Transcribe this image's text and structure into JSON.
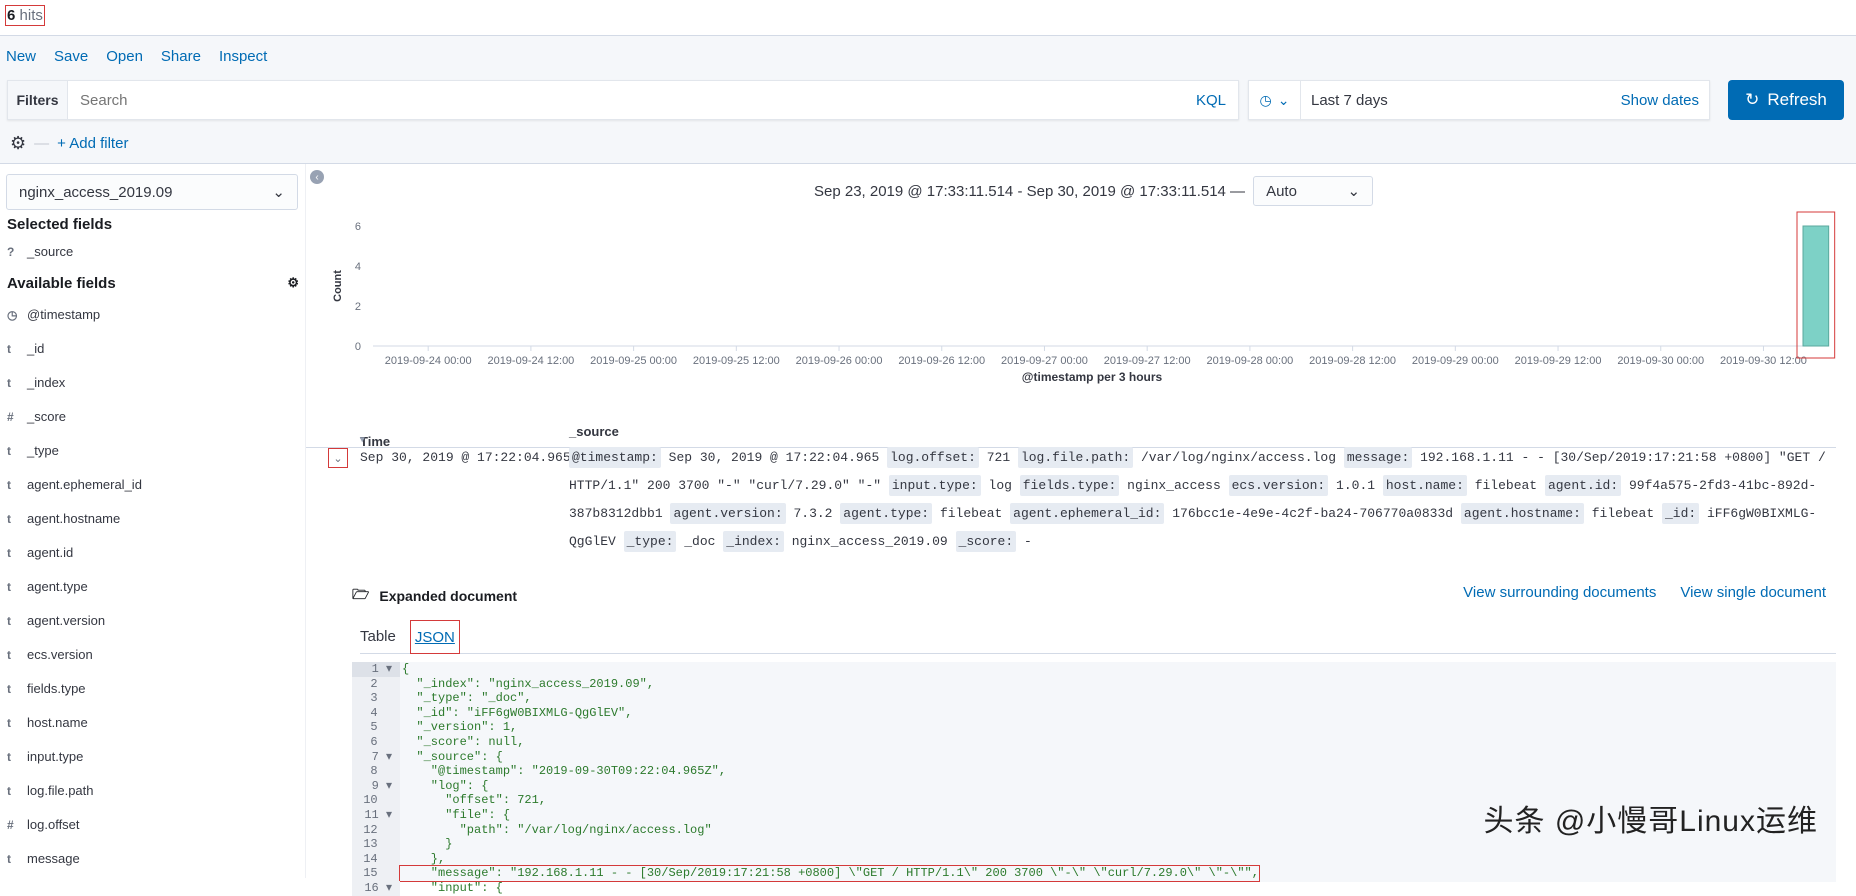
{
  "hits": {
    "count": "6",
    "label": "hits"
  },
  "menu": [
    "New",
    "Save",
    "Open",
    "Share",
    "Inspect"
  ],
  "filter": {
    "label": "Filters",
    "placeholder": "Search",
    "language": "KQL",
    "add_filter": "+ Add filter"
  },
  "time": {
    "range": "Last 7 days",
    "show_dates": "Show dates",
    "refresh": "Refresh"
  },
  "sidebar": {
    "index_pattern": "nginx_access_2019.09",
    "selected_title": "Selected fields",
    "selected": [
      {
        "icon": "?",
        "name": "_source"
      }
    ],
    "available_title": "Available fields",
    "available": [
      {
        "icon": "◷",
        "name": "@timestamp"
      },
      {
        "icon": "t",
        "name": "_id"
      },
      {
        "icon": "t",
        "name": "_index"
      },
      {
        "icon": "#",
        "name": "_score"
      },
      {
        "icon": "t",
        "name": "_type"
      },
      {
        "icon": "t",
        "name": "agent.ephemeral_id"
      },
      {
        "icon": "t",
        "name": "agent.hostname"
      },
      {
        "icon": "t",
        "name": "agent.id"
      },
      {
        "icon": "t",
        "name": "agent.type"
      },
      {
        "icon": "t",
        "name": "agent.version"
      },
      {
        "icon": "t",
        "name": "ecs.version"
      },
      {
        "icon": "t",
        "name": "fields.type"
      },
      {
        "icon": "t",
        "name": "host.name"
      },
      {
        "icon": "t",
        "name": "input.type"
      },
      {
        "icon": "t",
        "name": "log.file.path"
      },
      {
        "icon": "#",
        "name": "log.offset"
      },
      {
        "icon": "t",
        "name": "message"
      }
    ]
  },
  "histogram": {
    "range_text": "Sep 23, 2019 @ 17:33:11.514 - Sep 30, 2019 @ 17:33:11.514 —",
    "interval": "Auto"
  },
  "chart_data": {
    "type": "bar",
    "title": "",
    "xlabel": "@timestamp per 3 hours",
    "ylabel": "Count",
    "x_range": [
      "2019-09-23T17:33:11",
      "2019-09-30T17:33:11"
    ],
    "ylim": [
      0,
      6
    ],
    "yticks": [
      0,
      2,
      4,
      6
    ],
    "xticks": [
      "2019-09-24 00:00",
      "2019-09-24 12:00",
      "2019-09-25 00:00",
      "2019-09-25 12:00",
      "2019-09-26 00:00",
      "2019-09-26 12:00",
      "2019-09-27 00:00",
      "2019-09-27 12:00",
      "2019-09-28 00:00",
      "2019-09-28 12:00",
      "2019-09-29 00:00",
      "2019-09-29 12:00",
      "2019-09-30 00:00",
      "2019-09-30 12:00"
    ],
    "bars": [
      {
        "x": "2019-09-30T15:00:00",
        "value": 6
      }
    ],
    "bar_color": "#7dd1c6"
  },
  "table": {
    "headers": [
      "Time",
      "_source"
    ],
    "row": {
      "time": "Sep 30, 2019 @ 17:22:04.965",
      "fields": [
        [
          "@timestamp:",
          "Sep 30, 2019 @ 17:22:04.965"
        ],
        [
          "log.offset:",
          "721"
        ],
        [
          "log.file.path:",
          "/var/log/nginx/access.log"
        ],
        [
          "message:",
          "192.168.1.11 - - [30/Sep/2019:17:21:58 +0800] \"GET / HTTP/1.1\" 200 3700 \"-\" \"curl/7.29.0\" \"-\""
        ],
        [
          "input.type:",
          "log"
        ],
        [
          "fields.type:",
          "nginx_access"
        ],
        [
          "ecs.version:",
          "1.0.1"
        ],
        [
          "host.name:",
          "filebeat"
        ],
        [
          "agent.id:",
          "99f4a575-2fd3-41bc-892d-387b8312dbb1"
        ],
        [
          "agent.version:",
          "7.3.2"
        ],
        [
          "agent.type:",
          "filebeat"
        ],
        [
          "agent.ephemeral_id:",
          "176bcc1e-4e9e-4c2f-ba24-706770a0833d"
        ],
        [
          "agent.hostname:",
          "filebeat"
        ],
        [
          "_id:",
          "iFF6gW0BIXMLG-QgGlEV"
        ],
        [
          "_type:",
          "_doc"
        ],
        [
          "_index:",
          "nginx_access_2019.09"
        ],
        [
          "_score:",
          " -"
        ]
      ]
    }
  },
  "expanded": {
    "title": "Expanded document",
    "surrounding": "View surrounding documents",
    "single": "View single document",
    "tabs": [
      "Table",
      "JSON"
    ]
  },
  "json_lines": [
    "{",
    "  \"_index\": \"nginx_access_2019.09\",",
    "  \"_type\": \"_doc\",",
    "  \"_id\": \"iFF6gW0BIXMLG-QgGlEV\",",
    "  \"_version\": 1,",
    "  \"_score\": null,",
    "  \"_source\": {",
    "    \"@timestamp\": \"2019-09-30T09:22:04.965Z\",",
    "    \"log\": {",
    "      \"offset\": 721,",
    "      \"file\": {",
    "        \"path\": \"/var/log/nginx/access.log\"",
    "      }",
    "    },",
    "    \"message\": \"192.168.1.11 - - [30/Sep/2019:17:21:58 +0800] \\\"GET / HTTP/1.1\\\" 200 3700 \\\"-\\\" \\\"curl/7.29.0\\\" \\\"-\\\"\",",
    "    \"input\": {"
  ],
  "watermark": "头条 @小慢哥Linux运维"
}
